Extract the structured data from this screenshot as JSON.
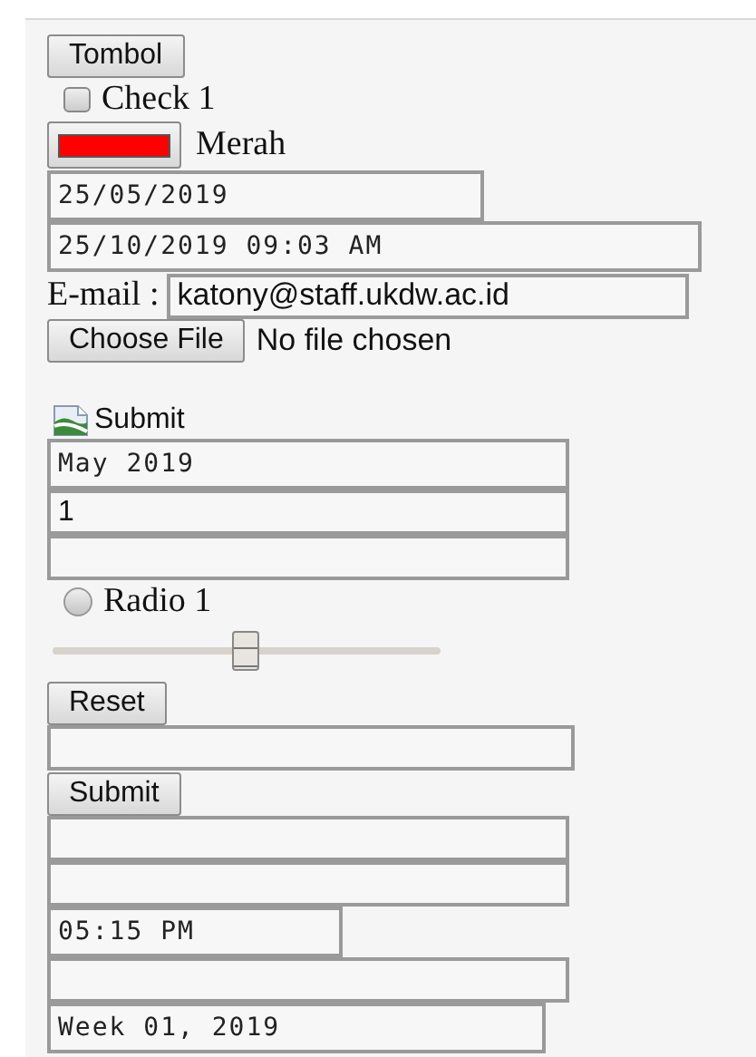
{
  "form": [
    {
      "kind": "button",
      "label": "Tombol"
    },
    {
      "kind": "checkbox",
      "label": "Check 1",
      "checked": false
    },
    {
      "kind": "color",
      "color": "#ff0000",
      "label": "Merah"
    },
    {
      "kind": "date",
      "value": "25/05/2019"
    },
    {
      "kind": "datetime",
      "value": "25/10/2019 09:03 AM"
    },
    {
      "kind": "email",
      "label": "E-mail :",
      "value": "katony@staff.ukdw.ac.id"
    },
    {
      "kind": "file",
      "button": "Choose File",
      "status": "No file chosen"
    },
    {
      "kind": "image-submit",
      "label": "Submit"
    },
    {
      "kind": "month",
      "value": "May 2019"
    },
    {
      "kind": "number",
      "value": "1"
    },
    {
      "kind": "text"
    },
    {
      "kind": "radio",
      "label": "Radio 1",
      "selected": false
    },
    {
      "kind": "range",
      "level": 0.5
    },
    {
      "kind": "button",
      "label": "Reset"
    },
    {
      "kind": "wide-text"
    },
    {
      "kind": "button",
      "label": "Submit"
    },
    {
      "kind": "text"
    },
    {
      "kind": "text"
    },
    {
      "kind": "time",
      "value": "05:15 PM"
    },
    {
      "kind": "text"
    },
    {
      "kind": "week",
      "value": "Week 01, 2019"
    }
  ]
}
